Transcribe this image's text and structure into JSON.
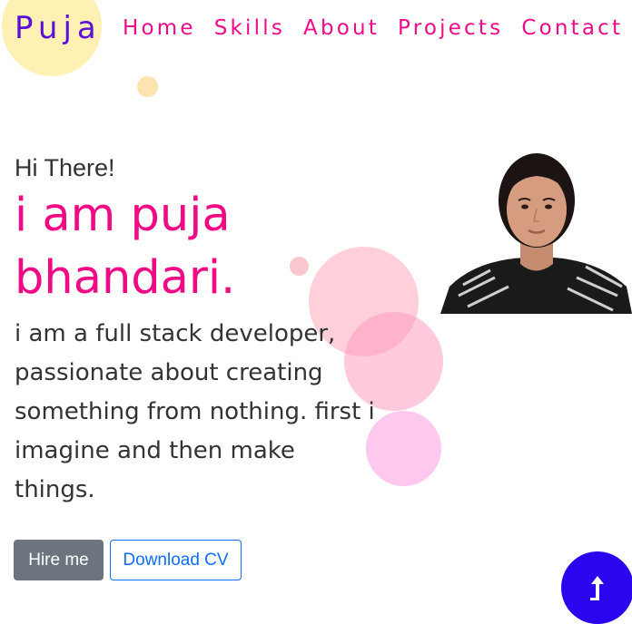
{
  "brand": {
    "logo_text": "Puja"
  },
  "nav": {
    "items": [
      {
        "label": "Home"
      },
      {
        "label": "Skills"
      },
      {
        "label": "About"
      },
      {
        "label": "Projects"
      },
      {
        "label": "Contact"
      }
    ]
  },
  "hero": {
    "greeting": "Hi There!",
    "name": "i am puja bhandari.",
    "bio": "i am a full stack developer, passionate about creating something from nothing. first i imagine and then make things.",
    "hire_label": "Hire me",
    "cv_label": "Download CV"
  },
  "scroll_top": {
    "icon": "arrow-up-icon"
  },
  "colors": {
    "brand": "#5b0fd8",
    "nav": "#ee0a8a",
    "name": "#f00a85",
    "hire_button": "#6c757d",
    "cv_button": "#0d6efd",
    "scroll_button": "#2a05ee"
  }
}
